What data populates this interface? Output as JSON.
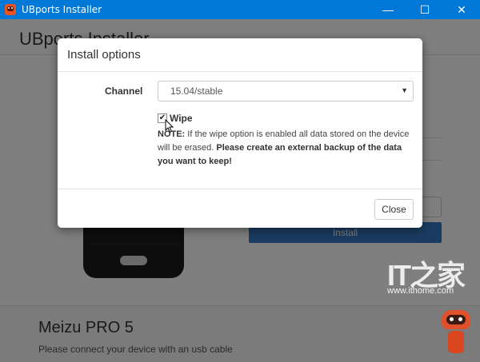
{
  "window": {
    "title": "UBports Installer",
    "controls": {
      "minimize": "—",
      "maximize": "☐",
      "close": "✕"
    }
  },
  "app": {
    "header": "UBports Installer",
    "install_label": "Install",
    "device": {
      "name": "Meizu PRO 5",
      "status": "Please connect your device with an usb cable"
    }
  },
  "modal": {
    "title": "Install options",
    "channel": {
      "label": "Channel",
      "selected": "15.04/stable"
    },
    "wipe": {
      "label": "Wipe",
      "checked": true
    },
    "note": {
      "prefix": "NOTE:",
      "text": " If the wipe option is enabled all data stored on the device will be erased. ",
      "emphasis": "Please create an external backup of the data you want to keep!"
    },
    "close_label": "Close"
  },
  "watermark": {
    "logo": "IT之家",
    "url": "www.ithome.com"
  },
  "colors": {
    "titlebar": "#0078d7",
    "install_button": "#3579c3",
    "overlay": "rgba(0,0,0,0.5)"
  }
}
